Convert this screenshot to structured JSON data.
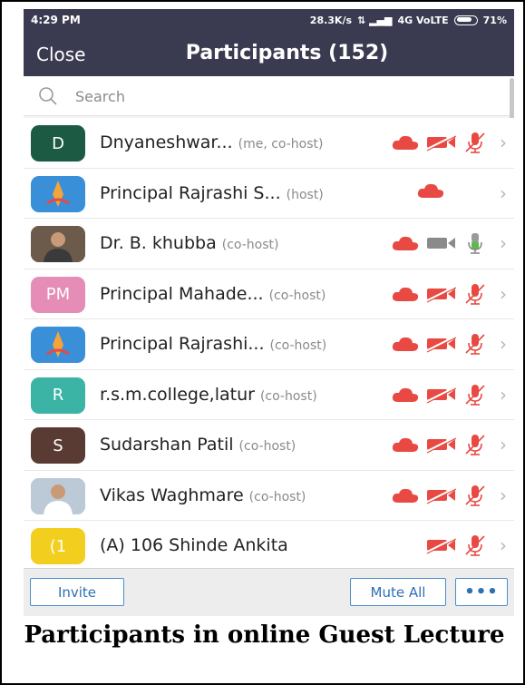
{
  "status_bar": {
    "time": "4:29 PM",
    "speed": "28.3K/s",
    "network": "4G VoLTE",
    "battery": "71%"
  },
  "header": {
    "close_label": "Close",
    "title": "Participants (152)"
  },
  "search": {
    "placeholder": "Search"
  },
  "participants": [
    {
      "avatar_text": "D",
      "avatar_color": "#1c5a44",
      "name": "Dnyaneshwar...",
      "tag": "(me, co-host)",
      "cloud": true,
      "video": "off",
      "mic": "off"
    },
    {
      "avatar_text": "",
      "avatar_color": "#3a8fd9",
      "name": "Principal Rajrashi S...",
      "tag": "(host)",
      "cloud": true,
      "video": "none",
      "mic": "none"
    },
    {
      "avatar_text": "",
      "avatar_color": "#7a6a5a",
      "name": "Dr. B. khubba",
      "tag": "(co-host)",
      "cloud": true,
      "video": "on",
      "mic": "on"
    },
    {
      "avatar_text": "PM",
      "avatar_color": "#e58cb7",
      "name": "Principal Mahade...",
      "tag": "(co-host)",
      "cloud": true,
      "video": "off",
      "mic": "off"
    },
    {
      "avatar_text": "",
      "avatar_color": "#3a8fd9",
      "name": "Principal Rajrashi...",
      "tag": "(co-host)",
      "cloud": true,
      "video": "off",
      "mic": "off"
    },
    {
      "avatar_text": "R",
      "avatar_color": "#3bb3a5",
      "name": "r.s.m.college,latur",
      "tag": "(co-host)",
      "cloud": true,
      "video": "off",
      "mic": "off"
    },
    {
      "avatar_text": "S",
      "avatar_color": "#5a3b34",
      "name": "Sudarshan Patil",
      "tag": "(co-host)",
      "cloud": true,
      "video": "off",
      "mic": "off"
    },
    {
      "avatar_text": "",
      "avatar_color": "#8fa0b5",
      "name": "Vikas Waghmare",
      "tag": "(co-host)",
      "cloud": true,
      "video": "off",
      "mic": "off"
    },
    {
      "avatar_text": "(1",
      "avatar_color": "#f2cf1e",
      "name": "(A) 106 Shinde Ankita",
      "tag": "",
      "cloud": false,
      "video": "off",
      "mic": "off"
    }
  ],
  "footer": {
    "invite_label": "Invite",
    "mute_all_label": "Mute All",
    "more_label": "•••"
  },
  "caption": "Participants in online Guest Lecture",
  "colors": {
    "accent_red": "#e84a43",
    "header_bg": "#3a3a50",
    "button_blue": "#2f6fb5"
  },
  "icons": {
    "cloud": "cloud-icon",
    "video": "video-camera-icon",
    "mic": "microphone-icon",
    "chevron": "chevron-right-icon",
    "search": "search-icon"
  }
}
